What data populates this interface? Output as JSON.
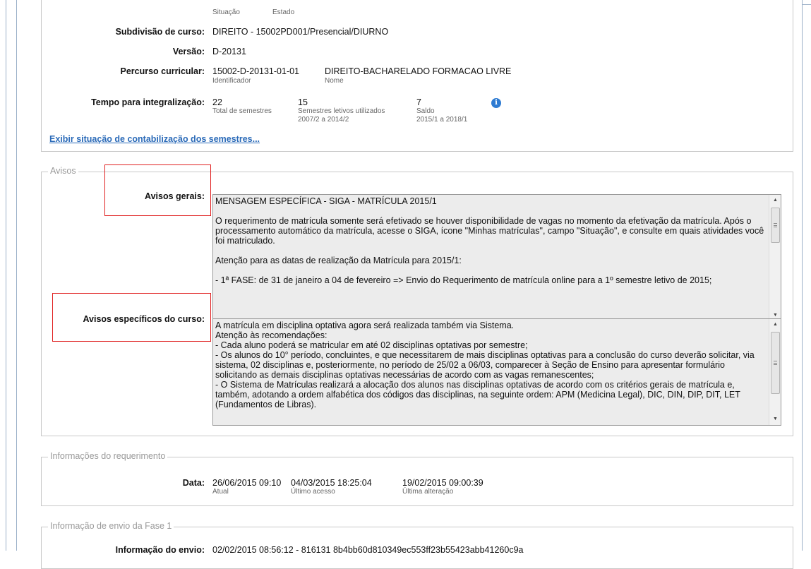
{
  "course": {
    "situacao_caption": "Situação",
    "estado_caption": "Estado",
    "subdivisao_label": "Subdivisão de curso:",
    "subdivisao_value": "DIREITO - 15002PD001/Presencial/DIURNO",
    "versao_label": "Versão:",
    "versao_value": "D-20131",
    "percurso_label": "Percurso curricular:",
    "percurso_id": "15002-D-20131-01-01",
    "percurso_id_caption": "Identificador",
    "percurso_nome": "DIREITO-BACHARELADO FORMACAO LIVRE",
    "percurso_nome_caption": "Nome",
    "tempo_label": "Tempo para integralização:",
    "tempo_total": "22",
    "tempo_total_caption": "Total de semestres",
    "tempo_usados": "15",
    "tempo_usados_caption": "Semestres letivos utilizados",
    "tempo_usados_range": "2007/2 a 2014/2",
    "tempo_saldo": "7",
    "tempo_saldo_caption": "Saldo",
    "tempo_saldo_range": "2015/1 a 2018/1",
    "info_icon_glyph": "i",
    "link_semestres": "Exibir situação de contabilização dos semestres..."
  },
  "avisos": {
    "legend": "Avisos",
    "gerais_label": "Avisos gerais:",
    "gerais_text": "MENSAGEM ESPECÍFICA - SIGA - MATRÍCULA 2015/1\n\nO requerimento de matrícula somente será efetivado se houver disponibilidade de vagas no momento da efetivação da matrícula. Após o processamento automático da matrícula, acesse o SIGA, ícone \"Minhas matrículas\", campo \"Situação\", e consulte em quais atividades você foi matriculado.\n\nAtenção para as datas de realização da Matrícula para 2015/1:\n\n- 1ª FASE: de 31 de janeiro a 04 de fevereiro => Envio do Requerimento de matrícula online para a 1º semestre letivo de 2015;",
    "especificos_label": "Avisos específicos do curso:",
    "especificos_text": "A matrícula em disciplina optativa agora será realizada também via Sistema.\nAtenção às recomendações:\n- Cada aluno poderá se matricular em até 02 disciplinas optativas por semestre;\n- Os alunos do 10° período, concluintes, e que necessitarem de mais disciplinas optativas para a conclusão do curso deverão solicitar, via sistema, 02 disciplinas e, posteriormente, no período de 25/02 a 06/03, comparecer à Seção de Ensino para apresentar formulário solicitando as demais disciplinas optativas necessárias de acordo com as vagas remanescentes;\n- O Sistema de Matrículas realizará a alocação dos alunos nas disciplinas optativas de acordo com os critérios gerais de matrícula e, também, adotando a ordem alfabética dos códigos das disciplinas, na seguinte ordem: APM (Medicina Legal), DIC, DIN, DIP, DIT, LET (Fundamentos de Libras)."
  },
  "requerimento": {
    "legend": "Informações do requerimento",
    "data_label": "Data:",
    "atual": "26/06/2015 09:10",
    "atual_caption": "Atual",
    "ultimo_acesso": "04/03/2015 18:25:04",
    "ultimo_acesso_caption": "Último acesso",
    "ultima_alteracao": "19/02/2015 09:00:39",
    "ultima_alteracao_caption": "Última alteração"
  },
  "envio": {
    "legend": "Informação de envio da Fase 1",
    "label": "Informação do envio:",
    "value": "02/02/2015 08:56:12 - 816131 8b4bb60d810349ec553ff23b55423abb41260c9a"
  },
  "colors": {
    "highlight_border": "#e02020",
    "link": "#2a6ab8",
    "textarea_bg": "#ececec"
  }
}
